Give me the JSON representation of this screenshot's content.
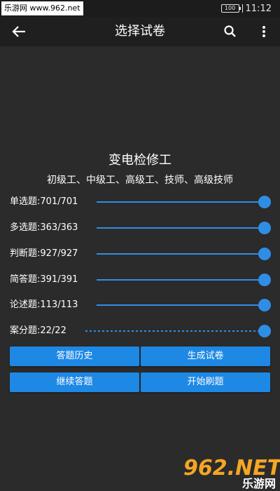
{
  "status_bar": {
    "watermark": "乐游网 www.962.net",
    "battery": "100",
    "time": "11:12"
  },
  "app_bar": {
    "title": "选择试卷",
    "back_icon": "arrow-left-icon",
    "search_icon": "search-icon",
    "more_icon": "more-vertical-icon"
  },
  "subject": {
    "title": "变电检修工",
    "levels": "初级工、中级工、高级工、技师、高级技师"
  },
  "question_types": [
    {
      "label": "单选题:701/701",
      "selected": 701,
      "total": 701,
      "track_style": "solid"
    },
    {
      "label": "多选题:363/363",
      "selected": 363,
      "total": 363,
      "track_style": "solid"
    },
    {
      "label": "判断题:927/927",
      "selected": 927,
      "total": 927,
      "track_style": "solid"
    },
    {
      "label": "简答题:391/391",
      "selected": 391,
      "total": 391,
      "track_style": "solid"
    },
    {
      "label": "论述题:113/113",
      "selected": 113,
      "total": 113,
      "track_style": "solid"
    },
    {
      "label": "案分题:22/22",
      "selected": 22,
      "total": 22,
      "track_style": "dotted"
    }
  ],
  "buttons": {
    "history": "答题历史",
    "generate": "生成试卷",
    "continue": "继续答题",
    "start": "开始刷题"
  },
  "colors": {
    "accent": "#2e8ee6",
    "button": "#1e88e5",
    "background": "#2b2b2b",
    "toolbar": "#1f1f1f"
  },
  "brand_logo": {
    "main": "962.NET",
    "sub": "乐游网"
  }
}
